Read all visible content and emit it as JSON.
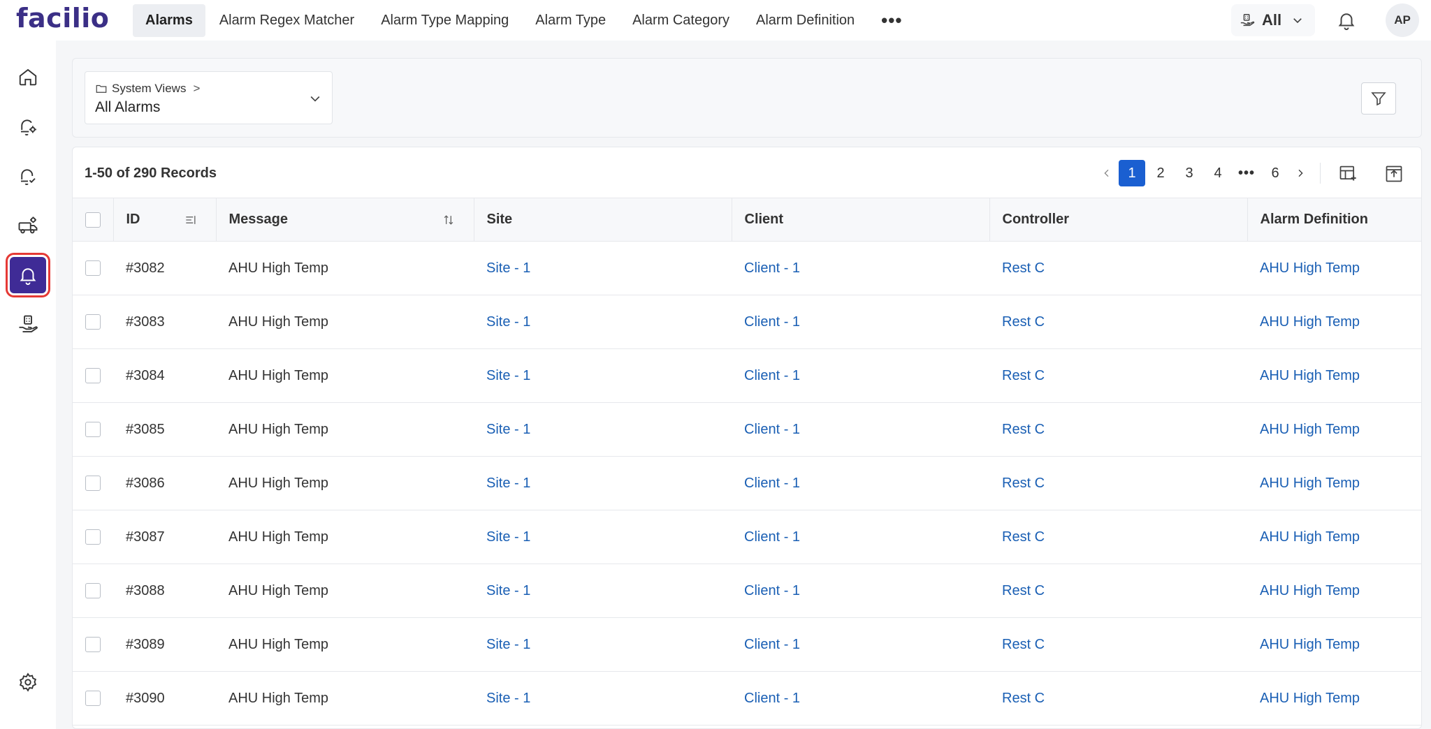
{
  "app": {
    "logo_text": "facilio",
    "brand_color": "#3b2f86",
    "accent_color": "#1a5fd1"
  },
  "header": {
    "tabs": [
      {
        "label": "Alarms",
        "active": true
      },
      {
        "label": "Alarm Regex Matcher",
        "active": false
      },
      {
        "label": "Alarm Type Mapping",
        "active": false
      },
      {
        "label": "Alarm Type",
        "active": false
      },
      {
        "label": "Alarm Category",
        "active": false
      },
      {
        "label": "Alarm Definition",
        "active": false
      }
    ],
    "more_label": "•••",
    "site_selector": {
      "icon": "building-hand-icon",
      "value": "All"
    },
    "notification_icon": "bell-icon",
    "avatar_initials": "AP"
  },
  "sidebar": {
    "items": [
      {
        "icon": "home-icon",
        "active": false
      },
      {
        "icon": "alarm-gear-icon",
        "active": false
      },
      {
        "icon": "alarm-check-icon",
        "active": false
      },
      {
        "icon": "truck-gear-icon",
        "active": false
      },
      {
        "icon": "bell-icon",
        "active": true
      },
      {
        "icon": "hand-building-icon",
        "active": false
      }
    ],
    "settings_icon": "settings-icon"
  },
  "view": {
    "breadcrumb": "System Views",
    "breadcrumb_sep": ">",
    "title": "All Alarms"
  },
  "table": {
    "records_label": "1-50 of 290 Records",
    "pagination": {
      "pages": [
        "1",
        "2",
        "3",
        "4",
        "•••",
        "6"
      ],
      "current": "1"
    },
    "columns": [
      "ID",
      "Message",
      "Site",
      "Client",
      "Controller",
      "Alarm Definition"
    ],
    "rows": [
      {
        "id": "#3082",
        "message": "AHU High Temp",
        "site": "Site - 1",
        "client": "Client - 1",
        "controller": "Rest C",
        "definition": "AHU High Temp"
      },
      {
        "id": "#3083",
        "message": "AHU High Temp",
        "site": "Site - 1",
        "client": "Client - 1",
        "controller": "Rest C",
        "definition": "AHU High Temp"
      },
      {
        "id": "#3084",
        "message": "AHU High Temp",
        "site": "Site - 1",
        "client": "Client - 1",
        "controller": "Rest C",
        "definition": "AHU High Temp"
      },
      {
        "id": "#3085",
        "message": "AHU High Temp",
        "site": "Site - 1",
        "client": "Client - 1",
        "controller": "Rest C",
        "definition": "AHU High Temp"
      },
      {
        "id": "#3086",
        "message": "AHU High Temp",
        "site": "Site - 1",
        "client": "Client - 1",
        "controller": "Rest C",
        "definition": "AHU High Temp"
      },
      {
        "id": "#3087",
        "message": "AHU High Temp",
        "site": "Site - 1",
        "client": "Client - 1",
        "controller": "Rest C",
        "definition": "AHU High Temp"
      },
      {
        "id": "#3088",
        "message": "AHU High Temp",
        "site": "Site - 1",
        "client": "Client - 1",
        "controller": "Rest C",
        "definition": "AHU High Temp"
      },
      {
        "id": "#3089",
        "message": "AHU High Temp",
        "site": "Site - 1",
        "client": "Client - 1",
        "controller": "Rest C",
        "definition": "AHU High Temp"
      },
      {
        "id": "#3090",
        "message": "AHU High Temp",
        "site": "Site - 1",
        "client": "Client - 1",
        "controller": "Rest C",
        "definition": "AHU High Temp"
      }
    ]
  }
}
